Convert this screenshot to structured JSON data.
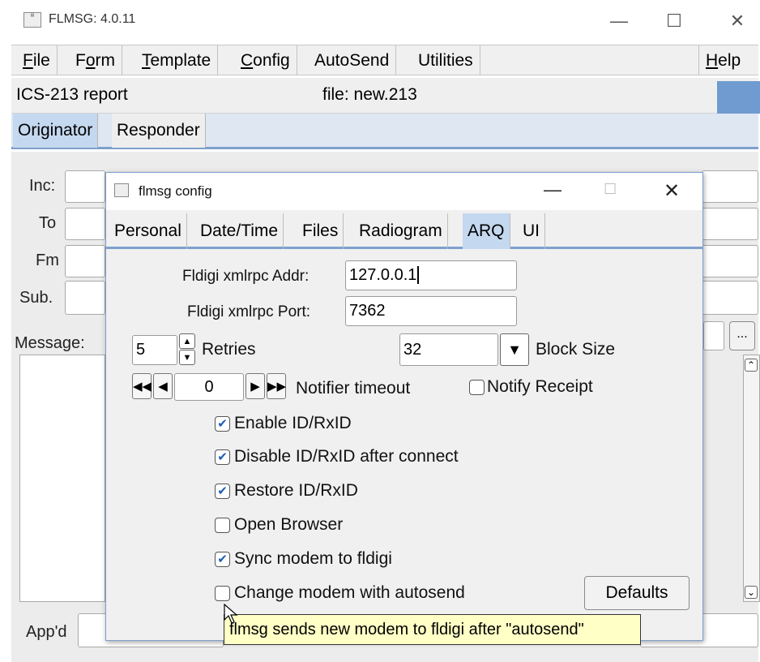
{
  "window": {
    "title": "FLMSG: 4.0.11",
    "minimize_icon": "minimize-icon",
    "maximize_icon": "maximize-icon",
    "close_icon": "close-icon"
  },
  "menubar": {
    "items": [
      {
        "pre": "",
        "u": "F",
        "post": "ile"
      },
      {
        "pre": "F",
        "u": "o",
        "post": "rm"
      },
      {
        "pre": "",
        "u": "T",
        "post": "emplate"
      },
      {
        "pre": "",
        "u": "C",
        "post": "onfig"
      },
      {
        "pre": "AutoSend",
        "u": "",
        "post": ""
      },
      {
        "pre": "Utilities",
        "u": "",
        "post": ""
      }
    ],
    "help": {
      "u": "H",
      "post": "elp"
    }
  },
  "infobar": {
    "form_name": "ICS-213 report",
    "file": "file: new.213"
  },
  "main_tabs": [
    "Originator",
    "Responder"
  ],
  "main_fields": {
    "inc_label": "Inc:",
    "to_label": "To",
    "fm_label": "Fm",
    "sub_label": "Sub.",
    "message_label": "Message:",
    "appd_label": "App'd",
    "more_button": "..."
  },
  "dialog": {
    "title": "flmsg config",
    "tabs": [
      "Personal",
      "Date/Time",
      "Files",
      "Radiogram",
      "ARQ",
      "UI"
    ],
    "selected_tab": "ARQ",
    "addr_label": "Fldigi xmlrpc Addr:",
    "addr_value": "127.0.0.1",
    "port_label": "Fldigi xmlrpc Port:",
    "port_value": "7362",
    "retries_value": "5",
    "retries_label": "Retries",
    "blocksize_value": "32",
    "blocksize_label": "Block Size",
    "notifier_value": "0",
    "notifier_label": "Notifier timeout",
    "notify_receipt_label": "Notify Receipt",
    "checkboxes": [
      {
        "label": "Enable ID/RxID",
        "checked": true
      },
      {
        "label": "Disable ID/RxID after connect",
        "checked": true
      },
      {
        "label": "Restore ID/RxID",
        "checked": true
      },
      {
        "label": "Open Browser",
        "checked": false
      },
      {
        "label": "Sync modem to fldigi",
        "checked": true
      },
      {
        "label": "Change modem with autosend",
        "checked": false
      }
    ],
    "defaults_button": "Defaults"
  },
  "tooltip": "flmsg sends new modem to fldigi after \"autosend\"",
  "colors": {
    "accent": "#7ea0cc",
    "selected_tab": "#c4d8ef",
    "tooltip_bg": "#ffffc6",
    "check": "#1a5fb4"
  }
}
